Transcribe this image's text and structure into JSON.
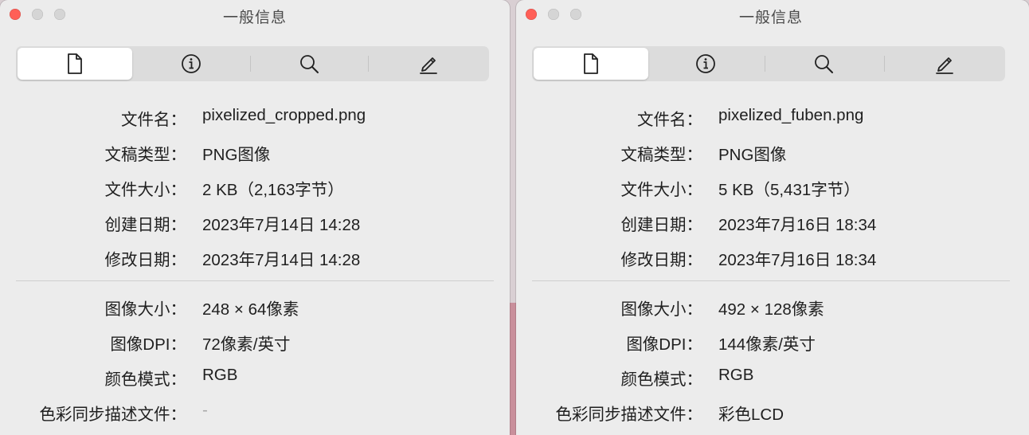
{
  "windows": [
    {
      "title": "一般信息",
      "tabs": [
        {
          "icon": "document-icon"
        },
        {
          "icon": "info-icon"
        },
        {
          "icon": "magnifier-icon"
        },
        {
          "icon": "pencil-icon"
        }
      ],
      "general": [
        {
          "label": "文件名：",
          "value": "pixelized_cropped.png"
        },
        {
          "label": "文稿类型：",
          "value": "PNG图像"
        },
        {
          "label": "文件大小：",
          "value": "2 KB（2,163字节）"
        },
        {
          "label": "创建日期：",
          "value": "2023年7月14日 14:28"
        },
        {
          "label": "修改日期：",
          "value": "2023年7月14日 14:28"
        }
      ],
      "image": [
        {
          "label": "图像大小：",
          "value": "248 × 64像素"
        },
        {
          "label": "图像DPI：",
          "value": "72像素/英寸"
        },
        {
          "label": "颜色模式：",
          "value": "RGB"
        },
        {
          "label": "色彩同步描述文件：",
          "value": "-"
        }
      ]
    },
    {
      "title": "一般信息",
      "tabs": [
        {
          "icon": "document-icon"
        },
        {
          "icon": "info-icon"
        },
        {
          "icon": "magnifier-icon"
        },
        {
          "icon": "pencil-icon"
        }
      ],
      "general": [
        {
          "label": "文件名：",
          "value": "pixelized_fuben.png"
        },
        {
          "label": "文稿类型：",
          "value": "PNG图像"
        },
        {
          "label": "文件大小：",
          "value": "5 KB（5,431字节）"
        },
        {
          "label": "创建日期：",
          "value": "2023年7月16日 18:34"
        },
        {
          "label": "修改日期：",
          "value": "2023年7月16日 18:34"
        }
      ],
      "image": [
        {
          "label": "图像大小：",
          "value": "492 × 128像素"
        },
        {
          "label": "图像DPI：",
          "value": "144像素/英寸"
        },
        {
          "label": "颜色模式：",
          "value": "RGB"
        },
        {
          "label": "色彩同步描述文件：",
          "value": "彩色LCD"
        }
      ]
    }
  ],
  "colors": {
    "close": "#ff5f57",
    "inactive_button": "#d5d5d5",
    "window_bg": "#ececec"
  }
}
